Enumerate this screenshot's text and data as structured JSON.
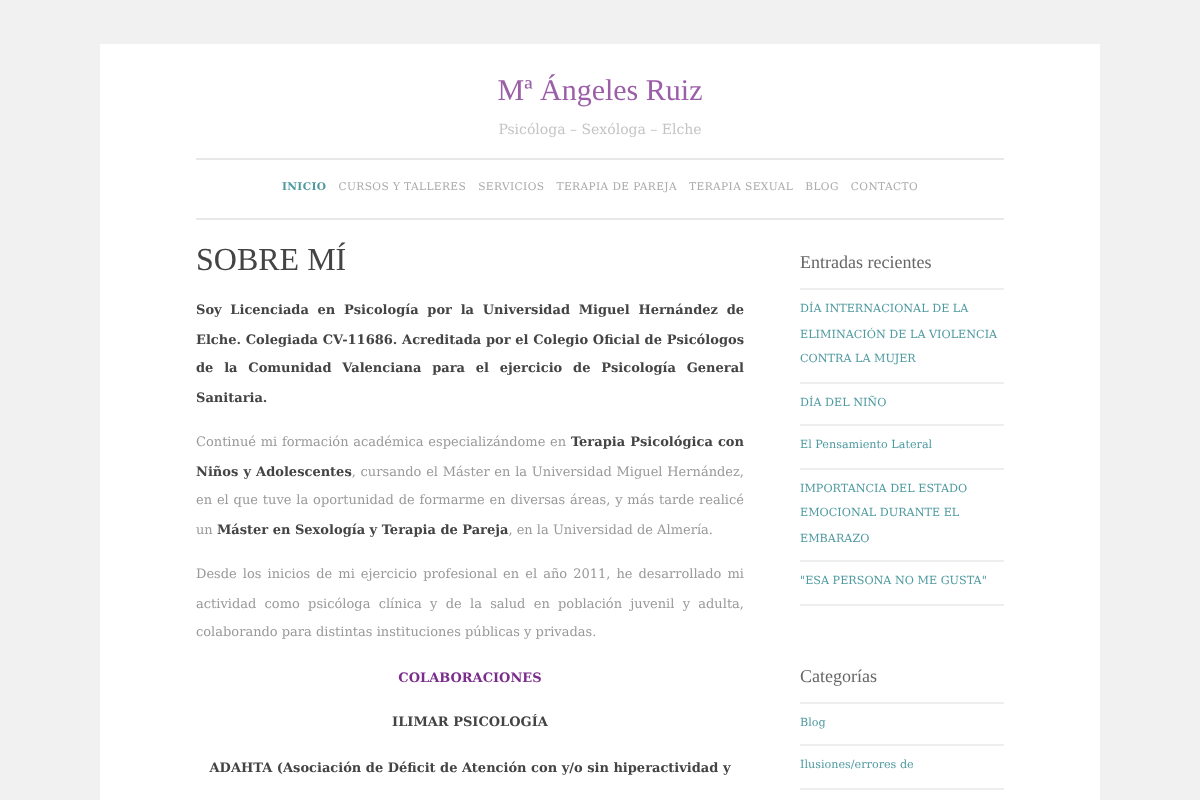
{
  "site": {
    "title": "Mª Ángeles Ruiz",
    "tagline": "Psicóloga – Sexóloga – Elche"
  },
  "nav": [
    {
      "label": "INICIO",
      "selected": true
    },
    {
      "label": "CURSOS Y TALLERES",
      "selected": false
    },
    {
      "label": "SERVICIOS",
      "selected": false
    },
    {
      "label": "TERAPIA DE PAREJA",
      "selected": false
    },
    {
      "label": "TERAPIA SEXUAL",
      "selected": false
    },
    {
      "label": "BLOG",
      "selected": false
    },
    {
      "label": "CONTACTO",
      "selected": false
    }
  ],
  "article": {
    "title": "SOBRE MÍ",
    "blocks": [
      {
        "kind": "lead",
        "text": "Soy Licenciada en Psicología por la Universidad Miguel Hernández de Elche. Colegiada CV-11686. Acreditada por el Colegio Oficial de Psicólogos de la Comunidad Valenciana para el ejercicio de Psicología General Sanitaria."
      },
      {
        "kind": "paragraph",
        "text": "Continué mi formación académica especializándome en **Terapia Psicológica con Niños y Adolescentes**, cursando el Máster en la Universidad Miguel Hernández, en el que tuve la oportunidad de formarme en diversas áreas, y más tarde realicé un **Máster en Sexología y Terapia de Pareja**, en la Universidad de Almería."
      },
      {
        "kind": "paragraph",
        "text": "Desde los inicios de mi ejercicio profesional en el año 2011, he desarrollado mi actividad como psicóloga clínica y de la salud en población juvenil y adulta, colaborando para distintas instituciones públicas y privadas."
      },
      {
        "kind": "heading",
        "text": "COLABORACIONES"
      },
      {
        "kind": "subheading",
        "text": "ILIMAR PSICOLOGÍA"
      },
      {
        "kind": "subheading",
        "text": "ADAHTA (Asociación de Déficit de Atención con y/o sin hiperactividad y"
      }
    ]
  },
  "sidebar": [
    {
      "title": "Entradas recientes",
      "items": [
        "DÍA INTERNACIONAL DE LA ELIMINACIÓN DE LA VIOLENCIA CONTRA LA MUJER",
        "DÍA DEL NIÑO",
        "El Pensamiento Lateral",
        "IMPORTANCIA DEL ESTADO EMOCIONAL DURANTE EL EMBARAZO",
        "\"ESA PERSONA NO ME GUSTA\""
      ]
    },
    {
      "title": "Categorías",
      "items": [
        "Blog",
        "Ilusiones/errores de"
      ]
    }
  ]
}
